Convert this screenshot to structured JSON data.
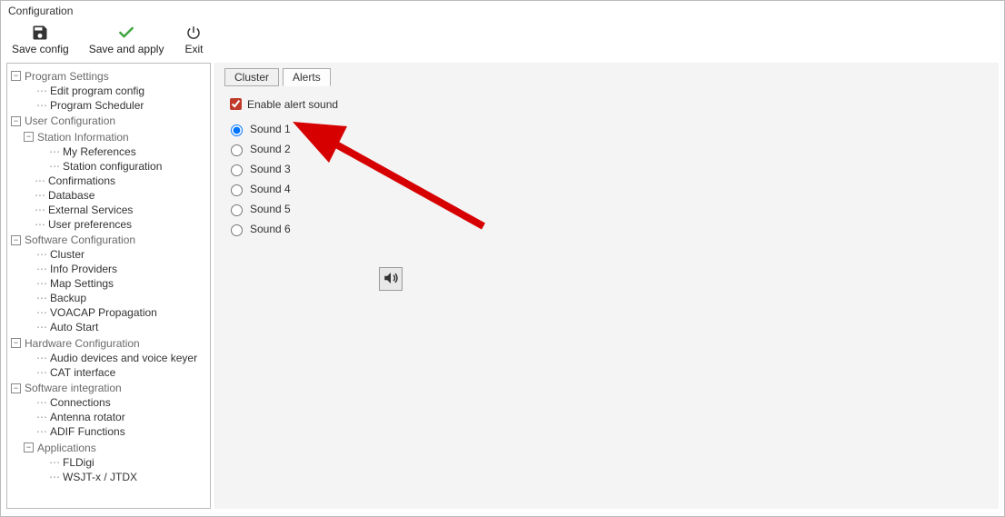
{
  "window_title": "Configuration",
  "toolbar": {
    "save_config": "Save config",
    "save_and_apply": "Save and apply",
    "exit": "Exit"
  },
  "tree": {
    "program_settings": {
      "label": "Program Settings",
      "children": {
        "edit_program_config": "Edit program config",
        "program_scheduler": "Program Scheduler"
      }
    },
    "user_configuration": {
      "label": "User Configuration",
      "children": {
        "station_information": {
          "label": "Station Information",
          "children": {
            "my_references": "My References",
            "station_configuration": "Station configuration"
          }
        },
        "confirmations": "Confirmations",
        "database": "Database",
        "external_services": "External Services",
        "user_preferences": "User preferences"
      }
    },
    "software_configuration": {
      "label": "Software Configuration",
      "children": {
        "cluster": "Cluster",
        "info_providers": "Info Providers",
        "map_settings": "Map Settings",
        "backup": "Backup",
        "vocap_propagation": "VOACAP Propagation",
        "auto_start": "Auto Start"
      }
    },
    "hardware_configuration": {
      "label": "Hardware Configuration",
      "children": {
        "audio_devices": "Audio devices and voice keyer",
        "cat_interface": "CAT interface"
      }
    },
    "software_integration": {
      "label": "Software integration",
      "children": {
        "connections": "Connections",
        "antenna_rotator": "Antenna rotator",
        "adif_functions": "ADIF Functions",
        "applications": {
          "label": "Applications",
          "children": {
            "fldigi": "FLDigi",
            "wsjtx": "WSJT-x / JTDX"
          }
        }
      }
    }
  },
  "tabs": {
    "cluster": "Cluster",
    "alerts": "Alerts",
    "active": "alerts"
  },
  "alerts_panel": {
    "enable_label": "Enable alert sound",
    "enabled": true,
    "selected_sound": "sound1",
    "sounds": {
      "sound1": "Sound 1",
      "sound2": "Sound 2",
      "sound3": "Sound 3",
      "sound4": "Sound 4",
      "sound5": "Sound 5",
      "sound6": "Sound 6"
    }
  },
  "annotation": {
    "arrow_color": "#d60000"
  }
}
